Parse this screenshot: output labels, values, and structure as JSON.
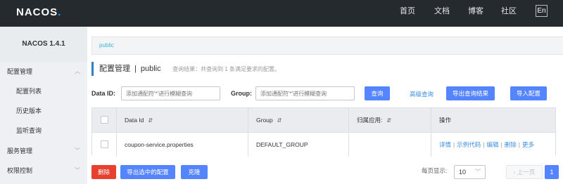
{
  "topbar": {
    "logo": "NACOS",
    "nav": [
      "首页",
      "文档",
      "博客",
      "社区"
    ],
    "lang": "En"
  },
  "sidebar": {
    "version": "NACOS 1.4.1",
    "items": [
      {
        "label": "配置管理",
        "type": "top",
        "expanded": true
      },
      {
        "label": "配置列表",
        "type": "sub"
      },
      {
        "label": "历史版本",
        "type": "sub"
      },
      {
        "label": "监听查询",
        "type": "sub"
      },
      {
        "label": "服务管理",
        "type": "top",
        "expanded": false
      },
      {
        "label": "权限控制",
        "type": "top",
        "expanded": false
      }
    ]
  },
  "breadcrumb": "public",
  "title": {
    "main": "配置管理",
    "sep": "|",
    "namespace": "public",
    "hint": "查询结果：共查询到 1 条满足要求的配置。"
  },
  "filters": {
    "data_id_label": "Data ID:",
    "data_id_placeholder": "添加通配符'*'进行模糊查询",
    "group_label": "Group:",
    "group_placeholder": "添加通配符'*'进行模糊查询",
    "query_btn": "查询",
    "advanced_link": "高级查询",
    "export_btn": "导出查询结果",
    "import_btn": "导入配置"
  },
  "table": {
    "headers": [
      "Data Id",
      "Group",
      "归属应用:",
      "操作"
    ],
    "rows": [
      {
        "data_id": "coupon-service.properties",
        "group": "DEFAULT_GROUP",
        "app": "",
        "ops": [
          "详情",
          "示例代码",
          "编辑",
          "删除",
          "更多"
        ]
      }
    ]
  },
  "footer": {
    "delete_btn": "删除",
    "export_selected_btn": "导出选中的配置",
    "clone_btn": "克隆",
    "page_size_label": "每页显示:",
    "page_size": "10",
    "prev": "上一页",
    "current_page": "1"
  },
  "colors": {
    "topbar": "#252a2f",
    "primary": "#5584ff",
    "danger": "#e7402e",
    "link": "#3a8ee6",
    "accent_bar": "#2f80c8"
  }
}
